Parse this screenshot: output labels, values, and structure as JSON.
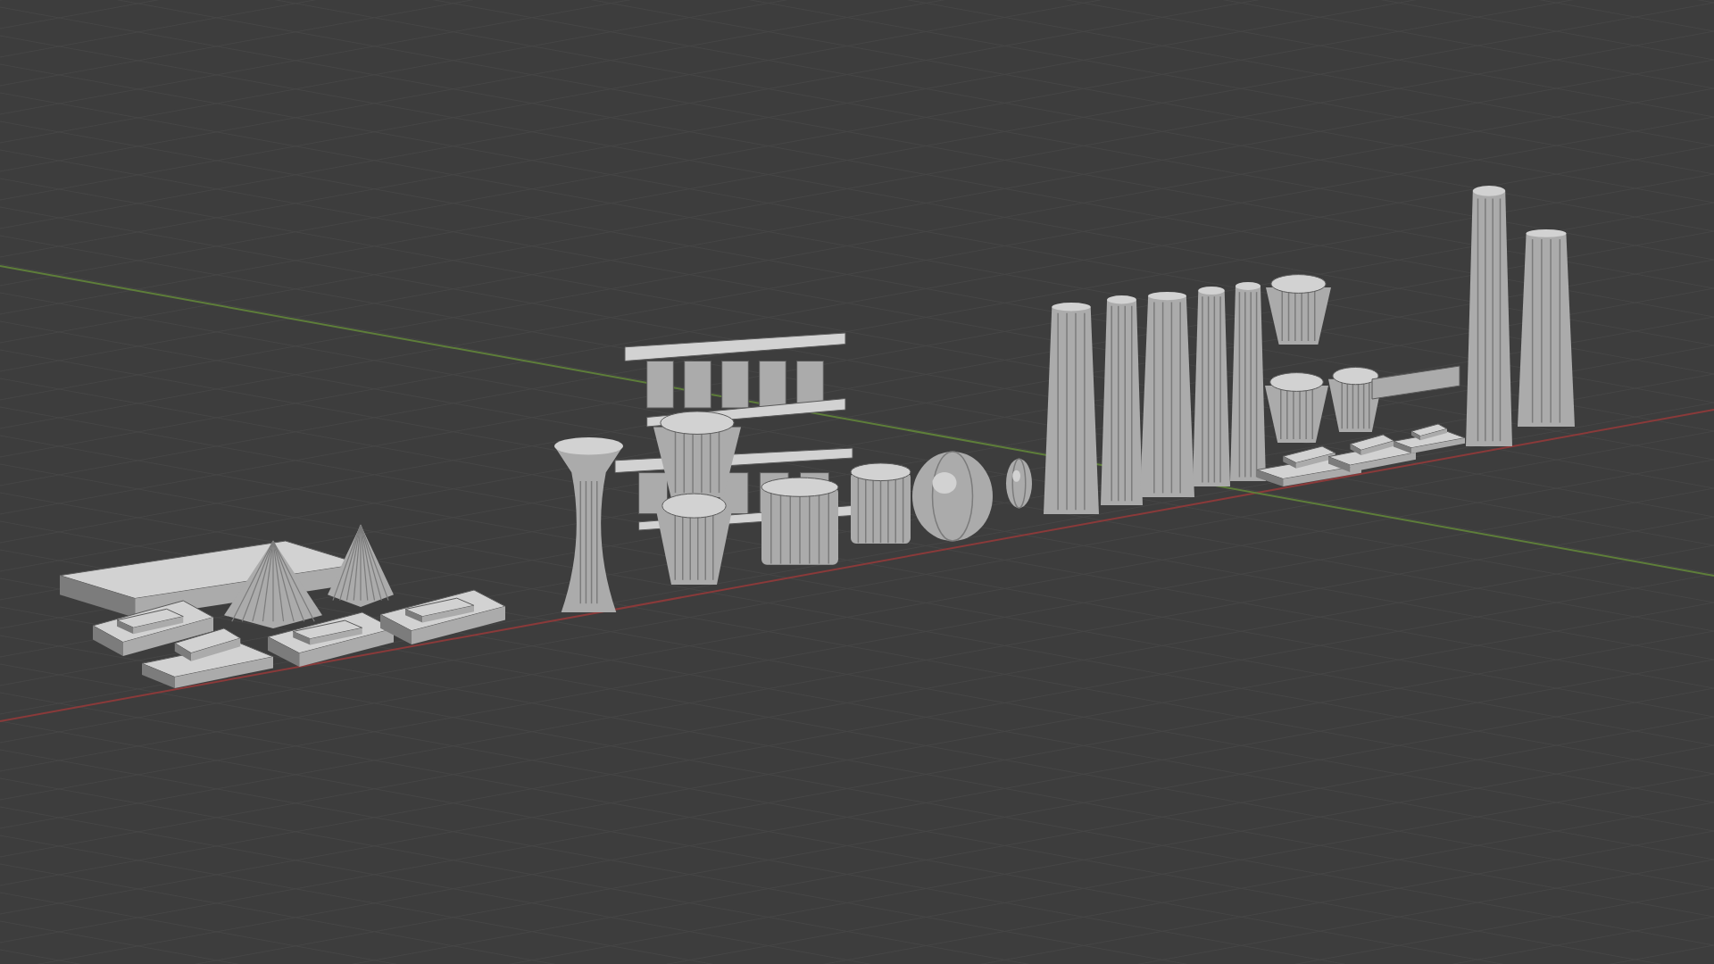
{
  "viewport": {
    "objects": [
      {
        "kind": "beam"
      },
      {
        "kind": "tray"
      },
      {
        "kind": "base"
      },
      {
        "kind": "cone"
      },
      {
        "kind": "cone"
      },
      {
        "kind": "tray"
      },
      {
        "kind": "tray"
      },
      {
        "kind": "vase"
      },
      {
        "kind": "colonnade"
      },
      {
        "kind": "colonnade"
      },
      {
        "kind": "capital"
      },
      {
        "kind": "capital"
      },
      {
        "kind": "drum"
      },
      {
        "kind": "drum"
      },
      {
        "kind": "sphere"
      },
      {
        "kind": "sphere"
      },
      {
        "kind": "column"
      },
      {
        "kind": "column"
      },
      {
        "kind": "column"
      },
      {
        "kind": "column"
      },
      {
        "kind": "column"
      },
      {
        "kind": "capital"
      },
      {
        "kind": "capital"
      },
      {
        "kind": "capital"
      },
      {
        "kind": "rail"
      },
      {
        "kind": "base"
      },
      {
        "kind": "base"
      },
      {
        "kind": "base"
      },
      {
        "kind": "column"
      },
      {
        "kind": "column"
      }
    ]
  }
}
